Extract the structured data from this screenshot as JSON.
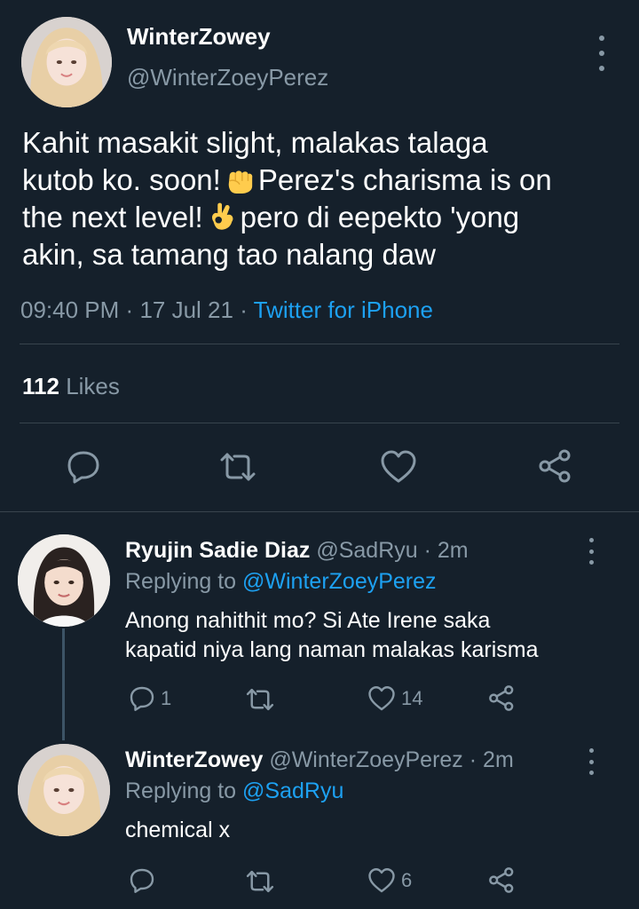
{
  "main_tweet": {
    "author_name": "WinterZowey",
    "author_handle": "@WinterZoeyPerez",
    "text_lines": [
      "Kahit masakit slight, malakas talaga",
      "kutob ko. soon!",
      "Perez's charisma is on",
      "the next level!",
      "pero di eepekto 'yong",
      "akin, sa tamang tao nalang daw"
    ],
    "time": "09:40 PM",
    "separator": "·",
    "date": "17 Jul 21",
    "source": "Twitter for iPhone",
    "likes_count": "112",
    "likes_label": "Likes"
  },
  "replies": [
    {
      "name": "Ryujin Sadie Diaz",
      "handle": "@SadRyu",
      "separator": "·",
      "time": "2m",
      "replying_label": "Replying to",
      "replying_to": "@WinterZoeyPerez",
      "text_lines": [
        "Anong nahithit mo? Si Ate Irene saka",
        "kapatid niya lang naman malakas karisma"
      ],
      "reply_count": "1",
      "retweet_count": "",
      "like_count": "14"
    },
    {
      "name": "WinterZowey",
      "handle": "@WinterZoeyPerez",
      "separator": "·",
      "time": "2m",
      "replying_label": "Replying to",
      "replying_to": "@SadRyu",
      "text_lines": [
        "chemical x"
      ],
      "reply_count": "",
      "retweet_count": "",
      "like_count": "6"
    }
  ],
  "icons": {
    "reply": "comment-bubble-icon",
    "retweet": "retweet-arrows-icon",
    "like": "heart-outline-icon",
    "share": "share-nodes-icon",
    "more": "vertical-dots-icon",
    "emoji_1": "raised-fist-emoji",
    "emoji_2": "ok-hand-emoji"
  },
  "colors": {
    "background": "#15202b",
    "text": "#ffffff",
    "muted": "#8899a6",
    "link": "#1da1f2",
    "divider": "#38444d"
  }
}
